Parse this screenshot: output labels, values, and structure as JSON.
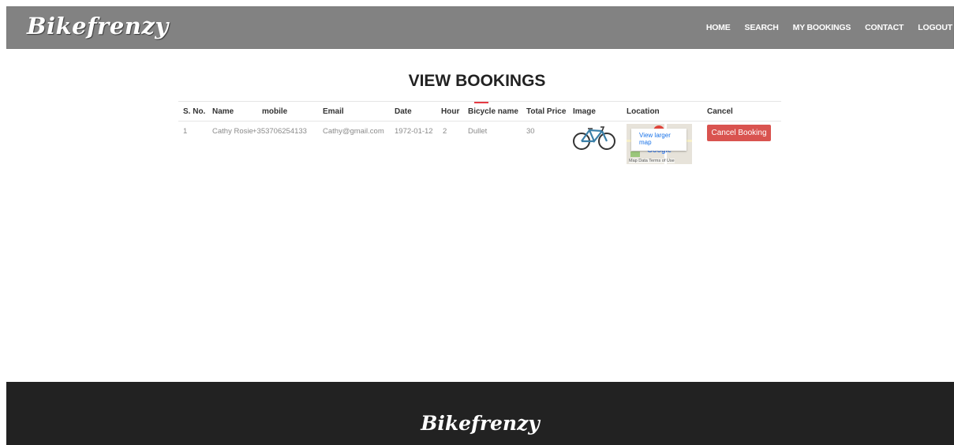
{
  "header": {
    "logo": "Bikefrenzy",
    "nav": [
      "HOME",
      "SEARCH",
      "MY BOOKINGS",
      "CONTACT",
      "LOGOUT"
    ]
  },
  "page": {
    "title": "VIEW BOOKINGS"
  },
  "table": {
    "headers": [
      "S. No.",
      "Name",
      "mobile",
      "Email",
      "Date",
      "Hour",
      "Bicycle name",
      "Total Price",
      "Image",
      "Location",
      "Cancel"
    ],
    "rows": [
      {
        "sno": "1",
        "name": "Cathy Rosie",
        "mobile": "+353706254133",
        "email": "Cathy@gmail.com",
        "date": "1972-01-12",
        "hour": "2",
        "bicycle": "Dullet",
        "price": "30",
        "image_icon": "bicycle-image",
        "map": {
          "link": "View larger map",
          "brand": "Google",
          "attribution": "Map Data   Terms of Use"
        },
        "cancel_label": "Cancel Booking"
      }
    ]
  },
  "footer": {
    "logo": "Bikefrenzy"
  },
  "colors": {
    "header_bg": "#828282",
    "footer_bg": "#222222",
    "accent": "#e53a44",
    "cancel_bg": "#d9534f"
  }
}
